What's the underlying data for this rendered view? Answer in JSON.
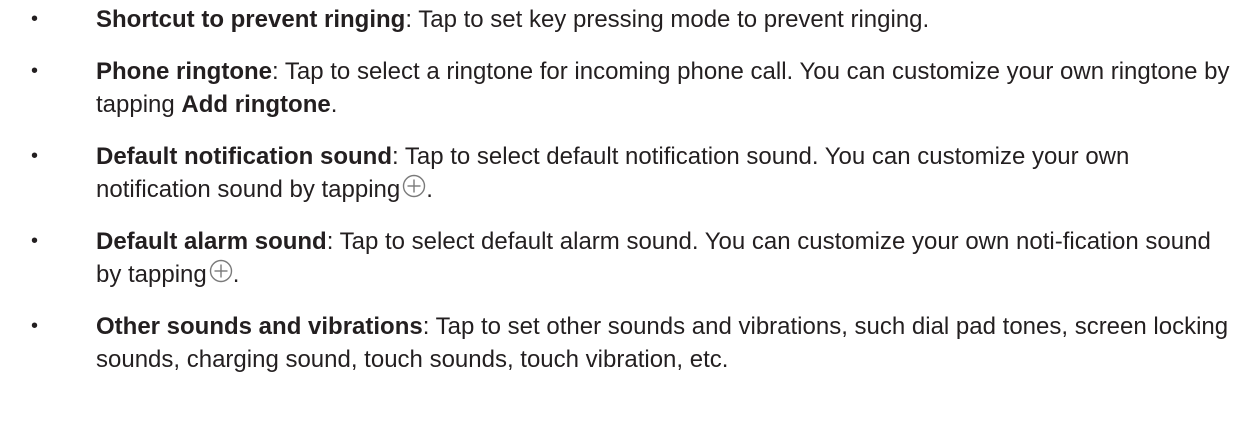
{
  "items": [
    {
      "term": "Shortcut to prevent ringing",
      "text": ": Tap to set key pressing mode to prevent ringing."
    },
    {
      "term": "Phone ringtone",
      "text": ": Tap to select a ringtone for incoming phone call. You can customize your own ringtone by tapping ",
      "bold_inline": "Add ringtone",
      "end": "."
    },
    {
      "term": "Default notification sound",
      "text": ": Tap to select default notification sound. You can customize your own notification sound by tapping",
      "icon": "add-circle-icon",
      "end": "."
    },
    {
      "term": "Default alarm sound",
      "text": ": Tap to select default alarm sound. You can customize your own noti-fication sound by tapping",
      "icon": "add-circle-icon",
      "end": "."
    },
    {
      "term": "Other sounds and vibrations",
      "text": ": Tap to set other sounds and vibrations, such dial pad tones, screen locking sounds, charging sound, touch sounds, touch vibration, etc."
    }
  ],
  "bullet_char": "•",
  "colors": {
    "text": "#231f20",
    "icon": "#7a7a7a"
  }
}
